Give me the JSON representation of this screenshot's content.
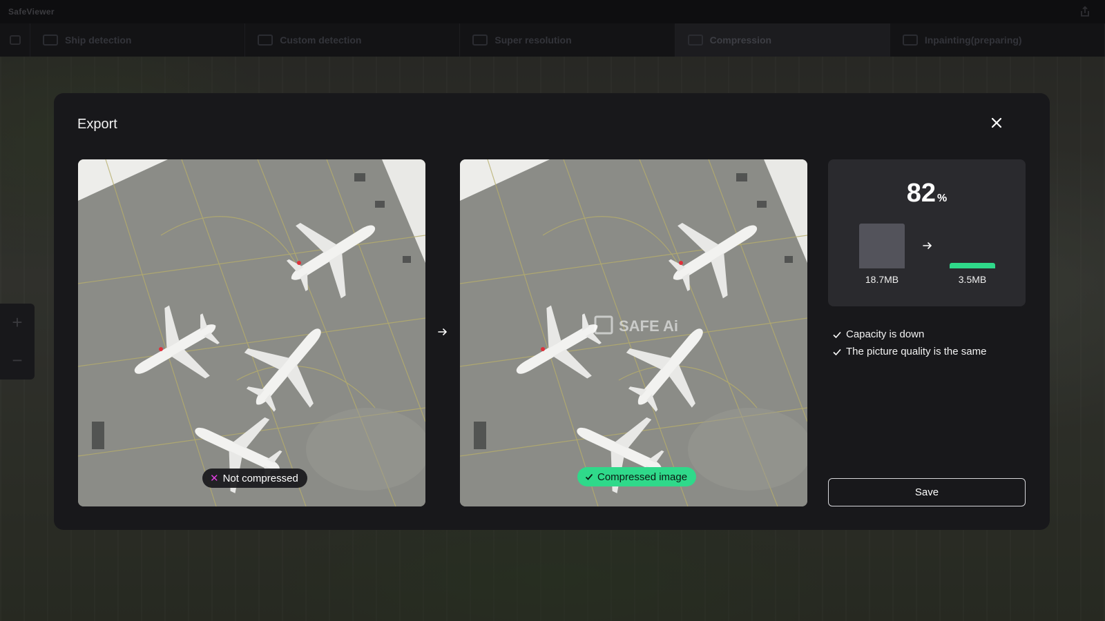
{
  "app": {
    "title": "SafeViewer"
  },
  "tabs": [
    {
      "label": "Ship detection",
      "active": false
    },
    {
      "label": "Custom detection",
      "active": false
    },
    {
      "label": "Super resolution",
      "active": false
    },
    {
      "label": "Compression",
      "active": true
    },
    {
      "label": "Inpainting(preparing)",
      "active": false
    }
  ],
  "zoom": {
    "in": "+",
    "out": "−"
  },
  "modal": {
    "title": "Export",
    "left_image": {
      "badge": "Not compressed",
      "badge_icon": "x-icon"
    },
    "right_image": {
      "badge": "Compressed image",
      "badge_icon": "check-icon",
      "watermark": "SAFE Ai"
    },
    "stats": {
      "percent": "82",
      "percent_unit": "%",
      "before_size": "18.7MB",
      "after_size": "3.5MB",
      "before_color": "#53535b",
      "after_color": "#2fd98a"
    },
    "checks": [
      "Capacity is down",
      "The picture quality is the same"
    ],
    "save_label": "Save"
  },
  "colors": {
    "accent_green": "#2fd98a",
    "not_compressed_x": "#e040e0",
    "modal_bg": "#18181b",
    "card_bg": "#2a2a2e"
  }
}
